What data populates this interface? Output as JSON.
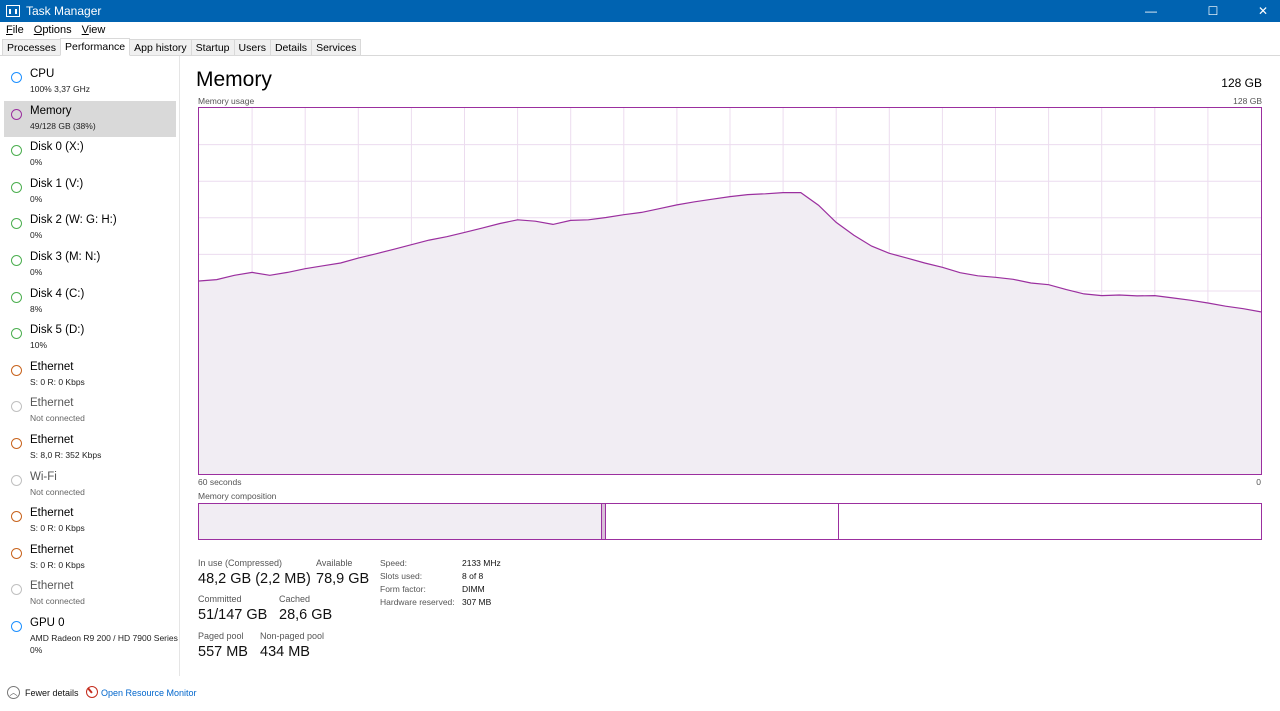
{
  "window": {
    "title": "Task Manager",
    "minimize": "—",
    "maximize": "☐",
    "close": "✕"
  },
  "menu": [
    "File",
    "Options",
    "View"
  ],
  "tabs": [
    "Processes",
    "Performance",
    "App history",
    "Startup",
    "Users",
    "Details",
    "Services"
  ],
  "active_tab": "Performance",
  "sidebar": [
    {
      "name": "CPU",
      "sub": "100% 3,37 GHz",
      "color": "#1e90ff"
    },
    {
      "name": "Memory",
      "sub": "49/128 GB (38%)",
      "color": "#9b2f9f",
      "selected": true
    },
    {
      "name": "Disk 0 (X:)",
      "sub": "0%",
      "color": "#4caf50"
    },
    {
      "name": "Disk 1 (V:)",
      "sub": "0%",
      "color": "#4caf50"
    },
    {
      "name": "Disk 2 (W: G: H:)",
      "sub": "0%",
      "color": "#4caf50"
    },
    {
      "name": "Disk 3 (M: N:)",
      "sub": "0%",
      "color": "#4caf50"
    },
    {
      "name": "Disk 4 (C:)",
      "sub": "8%",
      "color": "#4caf50"
    },
    {
      "name": "Disk 5 (D:)",
      "sub": "10%",
      "color": "#4caf50"
    },
    {
      "name": "Ethernet",
      "sub": "S: 0 R: 0 Kbps",
      "color": "#c8641e"
    },
    {
      "name": "Ethernet",
      "sub": "Not connected",
      "color": "#c0c0c0",
      "muted": true
    },
    {
      "name": "Ethernet",
      "sub": "S: 8,0 R: 352 Kbps",
      "color": "#c8641e"
    },
    {
      "name": "Wi-Fi",
      "sub": "Not connected",
      "color": "#c0c0c0",
      "muted": true
    },
    {
      "name": "Ethernet",
      "sub": "S: 0 R: 0 Kbps",
      "color": "#c8641e"
    },
    {
      "name": "Ethernet",
      "sub": "S: 0 R: 0 Kbps",
      "color": "#c8641e"
    },
    {
      "name": "Ethernet",
      "sub": "Not connected",
      "color": "#c0c0c0",
      "muted": true
    },
    {
      "name": "GPU 0",
      "sub": "AMD Radeon R9 200 / HD 7900 Series",
      "sub2": "0%",
      "color": "#1e90ff"
    }
  ],
  "main": {
    "title": "Memory",
    "total": "128 GB",
    "usage_label": "Memory usage",
    "usage_max": "128 GB",
    "time_left": "60 seconds",
    "time_right": "0",
    "composition_label": "Memory composition"
  },
  "chart_data": {
    "type": "area",
    "title": "Memory usage",
    "ylim": [
      0,
      128
    ],
    "xlim": [
      60,
      0
    ],
    "grid": true,
    "color": "#9b2f9f",
    "fill": "#f1edf3",
    "x": [
      60,
      59,
      58,
      57,
      56,
      55,
      54,
      53,
      52,
      51,
      50,
      49,
      48,
      47,
      46,
      45,
      44,
      43,
      42,
      41,
      40,
      39,
      38,
      37,
      36,
      35,
      34,
      33,
      32,
      31,
      30,
      29,
      28,
      27,
      26,
      25,
      24,
      23,
      22,
      21,
      20,
      19,
      18,
      17,
      16,
      15,
      14,
      13,
      12,
      11,
      10,
      9,
      8,
      7,
      6,
      5,
      4,
      3,
      2,
      1,
      0
    ],
    "values": [
      67.5,
      68,
      69.5,
      70.5,
      69.5,
      70.5,
      71.8,
      72.8,
      73.8,
      75.5,
      77,
      78.6,
      80.2,
      81.8,
      83,
      84.5,
      86,
      87.6,
      88.9,
      88.4,
      87.3,
      88.7,
      88.9,
      89.7,
      90.7,
      91.5,
      92.8,
      94.1,
      95.2,
      96.1,
      97,
      97.7,
      98,
      98.4,
      98.4,
      94,
      88,
      83.5,
      79.7,
      77.2,
      75.5,
      73.8,
      72.3,
      70.4,
      69.3,
      68.8,
      68.1,
      66.8,
      66.2,
      64.5,
      63,
      62.4,
      62.6,
      62.3,
      62.4,
      61.6,
      60.8,
      59.8,
      58.7,
      57.8,
      56.7
    ]
  },
  "composition": [
    {
      "name": "In use",
      "fraction": 0.379,
      "color": "#f1edf3"
    },
    {
      "name": "Modified",
      "fraction": 0.003,
      "color": "#d8bfd8"
    },
    {
      "name": "Standby",
      "fraction": 0.22,
      "color": "#ffffff"
    },
    {
      "name": "Free",
      "fraction": 0.398,
      "color": "#ffffff"
    }
  ],
  "stats": {
    "in_use_label": "In use (Compressed)",
    "in_use": "48,2 GB (2,2 MB)",
    "available_label": "Available",
    "available": "78,9 GB",
    "committed_label": "Committed",
    "committed": "51/147 GB",
    "cached_label": "Cached",
    "cached": "28,6 GB",
    "paged_label": "Paged pool",
    "paged": "557 MB",
    "nonpaged_label": "Non-paged pool",
    "nonpaged": "434 MB"
  },
  "details": [
    {
      "label": "Speed:",
      "value": "2133 MHz"
    },
    {
      "label": "Slots used:",
      "value": "8 of 8"
    },
    {
      "label": "Form factor:",
      "value": "DIMM"
    },
    {
      "label": "Hardware reserved:",
      "value": "307 MB"
    }
  ],
  "footer": {
    "fewer": "Fewer details",
    "resource": "Open Resource Monitor"
  }
}
